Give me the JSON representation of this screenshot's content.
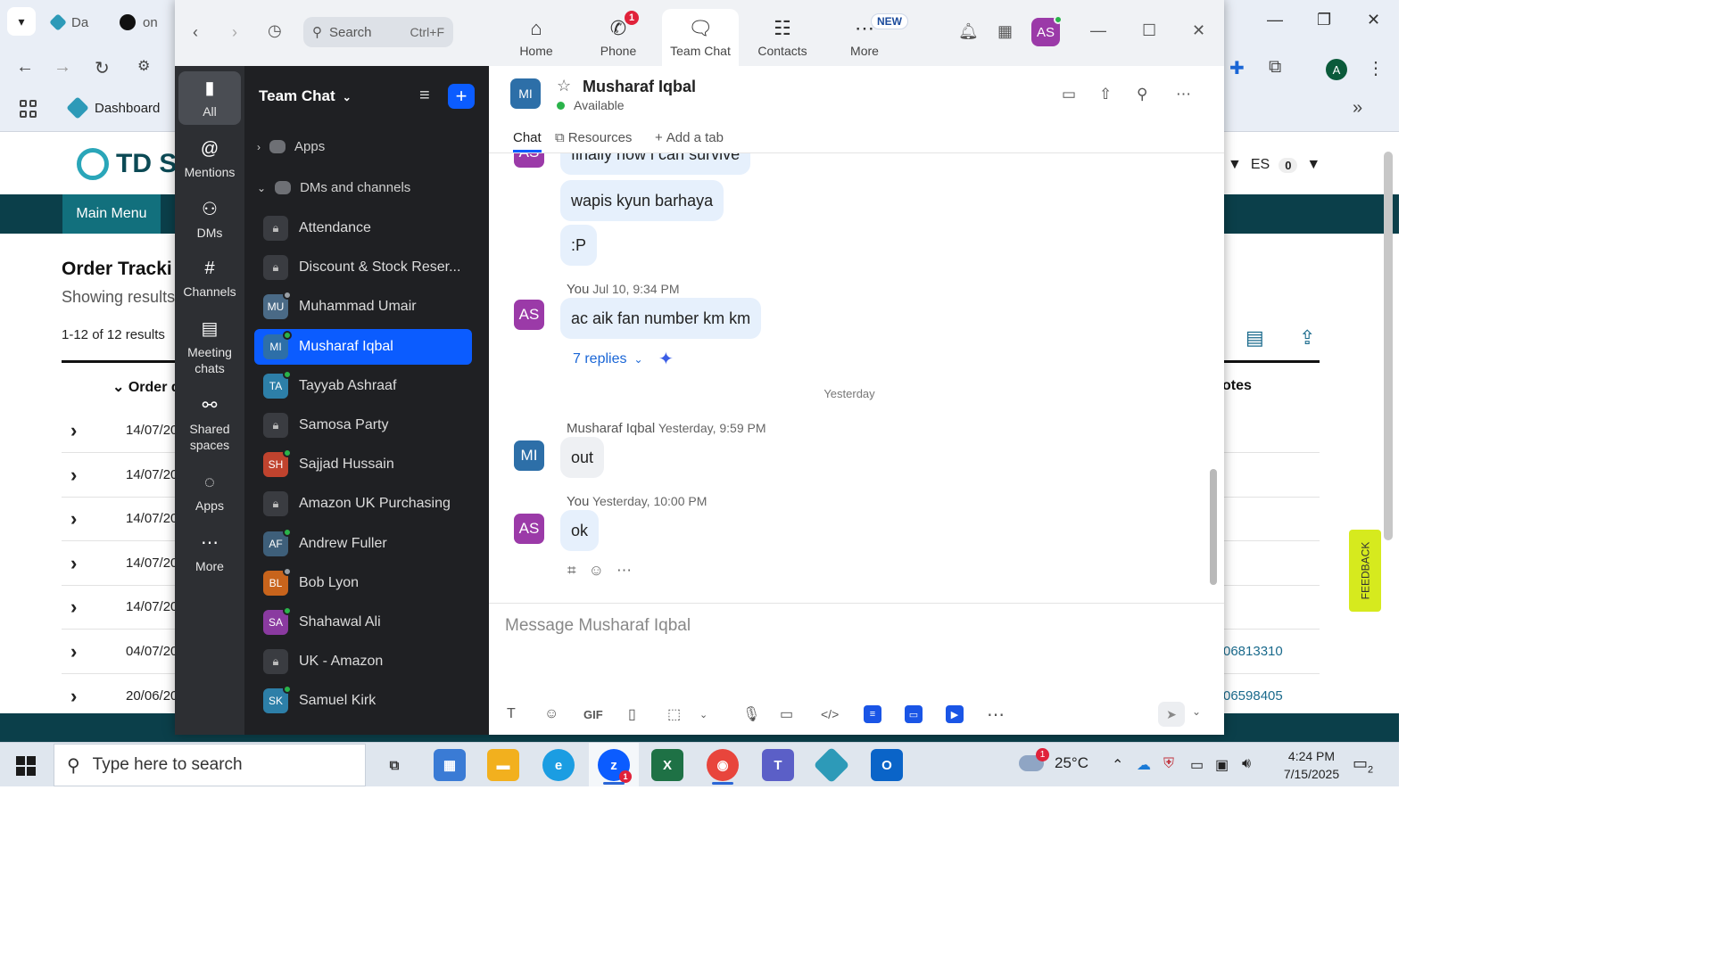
{
  "browser": {
    "tabs": [
      {
        "label": "Da",
        "fav_color": "#2d9ab8"
      },
      {
        "label": "on",
        "fav_color": "#111111"
      }
    ],
    "bookmark": "Dashboard"
  },
  "site": {
    "logo_text": "TD SY",
    "main_menu": "Main Menu",
    "page_title": "Order Tracki",
    "subtitle": "Showing results",
    "result_count": "1-12 of 12 results",
    "column_order": "Order d",
    "column_notes": "otes",
    "lang": "ES",
    "cart_count": "0",
    "feedback": "FEEDBACK",
    "rows": [
      {
        "date": "14/07/20",
        "note": ""
      },
      {
        "date": "14/07/20",
        "note": ""
      },
      {
        "date": "14/07/20",
        "note": ""
      },
      {
        "date": "14/07/20",
        "note": ""
      },
      {
        "date": "14/07/20",
        "note": ""
      },
      {
        "date": "04/07/20",
        "note": "06813310"
      },
      {
        "date": "20/06/20",
        "note": "06598405"
      }
    ]
  },
  "zoom": {
    "search": {
      "placeholder": "Search",
      "shortcut": "Ctrl+F"
    },
    "nav_tabs": [
      {
        "label": "Home",
        "icon": "home-icon"
      },
      {
        "label": "Phone",
        "icon": "phone-icon",
        "badge": "1"
      },
      {
        "label": "Team Chat",
        "icon": "chat-icon"
      },
      {
        "label": "Contacts",
        "icon": "contacts-icon"
      },
      {
        "label": "More",
        "icon": "more-icon",
        "new_label": "NEW"
      }
    ],
    "user_initials": "AS",
    "rail": [
      {
        "label": "All"
      },
      {
        "label": "Mentions"
      },
      {
        "label": "DMs"
      },
      {
        "label": "Channels"
      },
      {
        "label": "Meeting chats"
      },
      {
        "label": "Shared spaces"
      },
      {
        "label": "Apps"
      },
      {
        "label": "More"
      }
    ],
    "list": {
      "title": "Team Chat",
      "apps_section": "Apps",
      "dm_section": "DMs and channels",
      "items": [
        {
          "label": "Attendance",
          "initials": "",
          "color": "#3a3c41",
          "status": ""
        },
        {
          "label": "Discount & Stock Reser...",
          "initials": "",
          "color": "#3a3c41",
          "status": ""
        },
        {
          "label": "Muhammad Umair",
          "initials": "MU",
          "color": "#4a6a86",
          "status": "#9aa0a6"
        },
        {
          "label": "Musharaf Iqbal",
          "initials": "MI",
          "color": "#2d6fa8",
          "status": "#2ab34a"
        },
        {
          "label": "Tayyab Ashraaf",
          "initials": "TA",
          "color": "#2d7fa8",
          "status": "#2ab34a"
        },
        {
          "label": "Samosa Party",
          "initials": "",
          "color": "#3a3c41",
          "status": ""
        },
        {
          "label": "Sajjad Hussain",
          "initials": "SH",
          "color": "#c0432e",
          "status": "#2ab34a"
        },
        {
          "label": "Amazon UK Purchasing",
          "initials": "",
          "color": "#3a3c41",
          "status": ""
        },
        {
          "label": "Andrew Fuller",
          "initials": "AF",
          "color": "#3e5f7a",
          "status": "#2ab34a"
        },
        {
          "label": "Bob Lyon",
          "initials": "BL",
          "color": "#c8641c",
          "status": "#9aa0a6"
        },
        {
          "label": "Shahawal Ali",
          "initials": "SA",
          "color": "#8a3aa0",
          "status": "#2ab34a"
        },
        {
          "label": "UK - Amazon",
          "initials": "",
          "color": "#3a3c41",
          "status": ""
        },
        {
          "label": "Samuel Kirk",
          "initials": "SK",
          "color": "#2d7fa8",
          "status": "#2ab34a"
        }
      ]
    },
    "conversation": {
      "initials": "MI",
      "name": "Musharaf Iqbal",
      "status": "Available",
      "tabs": [
        "Chat",
        "Resources",
        "Add a tab"
      ],
      "partial_top": "finally now i can survive",
      "msg_barhaya": "wapis kyun barhaya",
      "msg_p": ":P",
      "you_label": "You",
      "time1": "Jul 10, 9:34 PM",
      "msg_fan": "ac aik fan number km km",
      "replies": "7 replies",
      "day": "Yesterday",
      "sender2": "Musharaf Iqbal",
      "time2": "Yesterday, 9:59 PM",
      "msg_out": "out",
      "time3": "Yesterday, 10:00 PM",
      "msg_ok": "ok",
      "composer_placeholder": "Message Musharaf Iqbal"
    }
  },
  "taskbar": {
    "search_placeholder": "Type here to search",
    "temperature": "25°C",
    "weather_badge": "1",
    "zoom_badge": "1",
    "time": "4:24 PM",
    "date": "7/15/2025",
    "notifications": "2"
  }
}
